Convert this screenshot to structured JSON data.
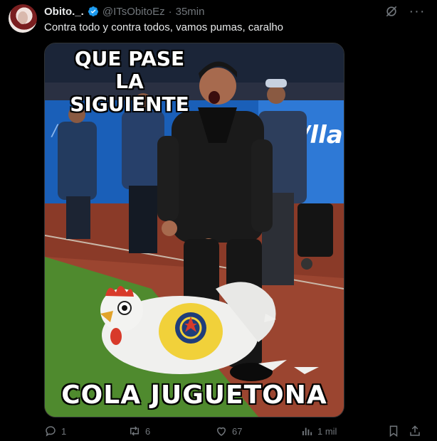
{
  "tweet": {
    "author_name": "Obito._.",
    "handle": "@ITsObitoEz",
    "separator": "·",
    "time": "35min",
    "text": "Contra todo y contra todos, vamos pumas, caralho"
  },
  "media": {
    "caption_top_line1": "QUE PASE",
    "caption_top_line2": "LA SIGUIENTE",
    "caption_bottom": "COLA  JUGUETONA"
  },
  "stats": {
    "replies": "1",
    "reposts": "6",
    "likes": "67",
    "views": "1 mil"
  },
  "icons": {
    "verified": "verified-badge-icon",
    "grok": "grok-icon",
    "more": "more-icon",
    "reply": "reply-icon",
    "repost": "repost-icon",
    "like": "heart-icon",
    "views": "views-icon",
    "bookmark": "bookmark-icon",
    "share": "share-icon"
  },
  "colors": {
    "background": "#000000",
    "text": "#e7e9ea",
    "muted": "#71767b",
    "verified": "#1d9bf0"
  }
}
